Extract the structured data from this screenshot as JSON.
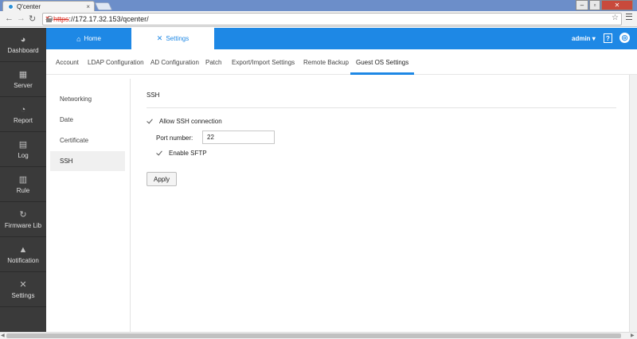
{
  "browser": {
    "tab_title": "Q'center",
    "tab_close": "×",
    "url_scheme": "https",
    "url_rest": "://172.17.32.153/qcenter/",
    "controls": {
      "minimize": "–",
      "maximize": "▫",
      "close": "✕"
    }
  },
  "sidebar": {
    "items": [
      {
        "label": "Dashboard",
        "icon": "speedometer-icon",
        "glyph": "◕"
      },
      {
        "label": "Server",
        "icon": "server-icon",
        "glyph": "▦"
      },
      {
        "label": "Report",
        "icon": "pie-chart-icon",
        "glyph": "◔"
      },
      {
        "label": "Log",
        "icon": "document-icon",
        "glyph": "▤"
      },
      {
        "label": "Rule",
        "icon": "book-icon",
        "glyph": "▥"
      },
      {
        "label": "Firmware Lib",
        "icon": "refresh-icon",
        "glyph": "↻"
      },
      {
        "label": "Notification",
        "icon": "bell-icon",
        "glyph": "▲"
      },
      {
        "label": "Settings",
        "icon": "tools-icon",
        "glyph": "✕"
      }
    ]
  },
  "topnav": {
    "home_label": "Home",
    "settings_label": "Settings",
    "user": "admin ▾",
    "help_glyph": "?",
    "globe_glyph": "◎"
  },
  "subtabs": [
    "Account",
    "LDAP Configuration",
    "AD Configuration",
    "Patch",
    "Export/Import Settings",
    "Remote Backup",
    "Guest OS Settings"
  ],
  "left_nav": [
    "Networking",
    "Date",
    "Certificate",
    "SSH"
  ],
  "ssh": {
    "title": "SSH",
    "allow_label": "Allow SSH connection",
    "allow_checked": true,
    "port_label": "Port number:",
    "port_value": "22",
    "sftp_label": "Enable SFTP",
    "sftp_checked": true,
    "apply_label": "Apply"
  },
  "colors": {
    "accent": "#1e88e5",
    "sidebar": "#3a3a3a"
  }
}
